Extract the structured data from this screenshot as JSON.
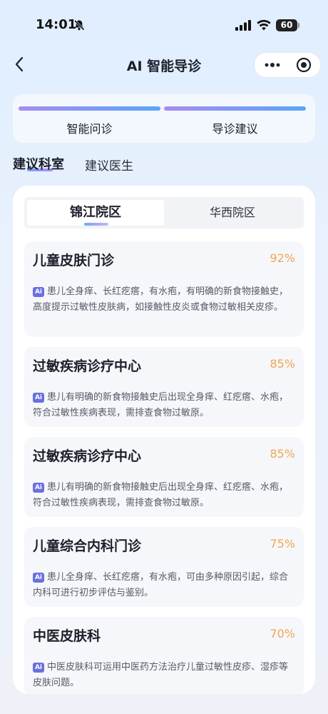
{
  "status_bar": {
    "time": "14:01",
    "battery": "60"
  },
  "nav": {
    "title": "AI 智能导诊"
  },
  "steps": [
    {
      "label": "智能问诊"
    },
    {
      "label": "导诊建议"
    }
  ],
  "tabs": {
    "active": "建议科室",
    "inactive": "建议医生"
  },
  "campus": {
    "active": "锦江院区",
    "inactive": "华西院区"
  },
  "ai_badge": "Ai",
  "departments": [
    {
      "name": "儿童皮肤门诊",
      "score": "92%",
      "reason": "患儿全身痒、长红疙瘩，有水疱，有明确的新食物接触史，高度提示过敏性皮肤病，如接触性皮炎或食物过敏相关皮疹。"
    },
    {
      "name": "过敏疾病诊疗中心",
      "score": "85%",
      "reason": "患儿有明确的新食物接触史后出现全身痒、红疙瘩、水疱，符合过敏性疾病表现，需排查食物过敏原。"
    },
    {
      "name": "过敏疾病诊疗中心",
      "score": "85%",
      "reason": "患儿有明确的新食物接触史后出现全身痒、红疙瘩、水疱，符合过敏性疾病表现，需排查食物过敏原。"
    },
    {
      "name": "儿童综合内科门诊",
      "score": "75%",
      "reason": "患儿全身痒、长红疙瘩，有水疱，可由多种原因引起，综合内科可进行初步评估与鉴别。"
    },
    {
      "name": "中医皮肤科",
      "score": "70%",
      "reason": "中医皮肤科可运用中医药方法治疗儿童过敏性皮疹、湿疹等皮肤问题。"
    }
  ]
}
